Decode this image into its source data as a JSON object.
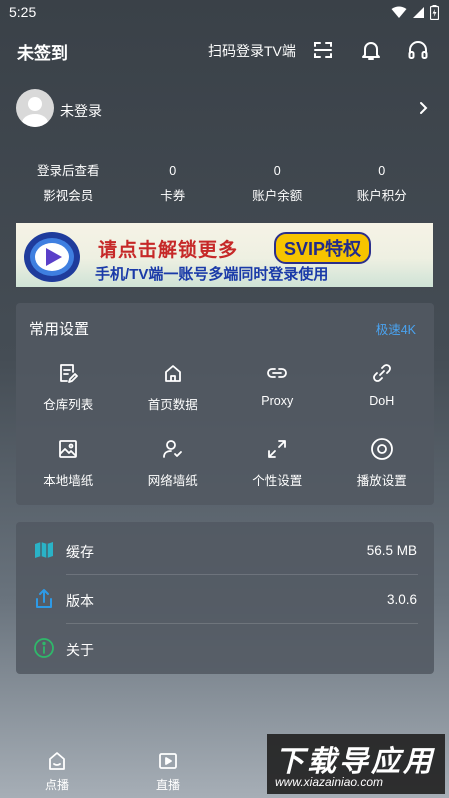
{
  "status_bar": {
    "time": "5:25"
  },
  "header": {
    "title": "未签到",
    "scan_label": "扫码登录TV端",
    "icons": [
      "scan-icon",
      "bell-icon",
      "headphones-icon"
    ]
  },
  "user": {
    "name": "未登录"
  },
  "stats": [
    {
      "value": "登录后查看",
      "label": "影视会员"
    },
    {
      "value": "0",
      "label": "卡券"
    },
    {
      "value": "0",
      "label": "账户余额"
    },
    {
      "value": "0",
      "label": "账户积分"
    }
  ],
  "banner": {
    "line1": "请点击解锁更多",
    "pill": "SVIP特权",
    "line2": "手机/TV端一账号多端同时登录使用"
  },
  "settings": {
    "title": "常用设置",
    "link": "极速4K",
    "items": [
      {
        "label": "仓库列表",
        "icon": "document-edit-icon"
      },
      {
        "label": "首页数据",
        "icon": "home-icon"
      },
      {
        "label": "Proxy",
        "icon": "link-icon"
      },
      {
        "label": "DoH",
        "icon": "chain-icon"
      },
      {
        "label": "本地墙纸",
        "icon": "image-icon"
      },
      {
        "label": "网络墙纸",
        "icon": "user-check-icon"
      },
      {
        "label": "个性设置",
        "icon": "expand-icon"
      },
      {
        "label": "播放设置",
        "icon": "play-circle-icon"
      }
    ]
  },
  "info": {
    "rows": [
      {
        "label": "缓存",
        "value": "56.5 MB",
        "icon": "map-icon",
        "color": "#2ab3c7"
      },
      {
        "label": "版本",
        "value": "3.0.6",
        "icon": "share-icon",
        "color": "#2e9ae6"
      },
      {
        "label": "关于",
        "value": "",
        "icon": "info-icon",
        "color": "#2fb86a"
      }
    ]
  },
  "bottom_nav": [
    {
      "label": "点播",
      "icon": "home-nav-icon"
    },
    {
      "label": "直播",
      "icon": "tv-play-icon"
    },
    {
      "label": "",
      "icon": "nav-third-icon"
    }
  ],
  "watermark": {
    "big": "下载导应用",
    "small": "www.xiazainiao.com"
  }
}
